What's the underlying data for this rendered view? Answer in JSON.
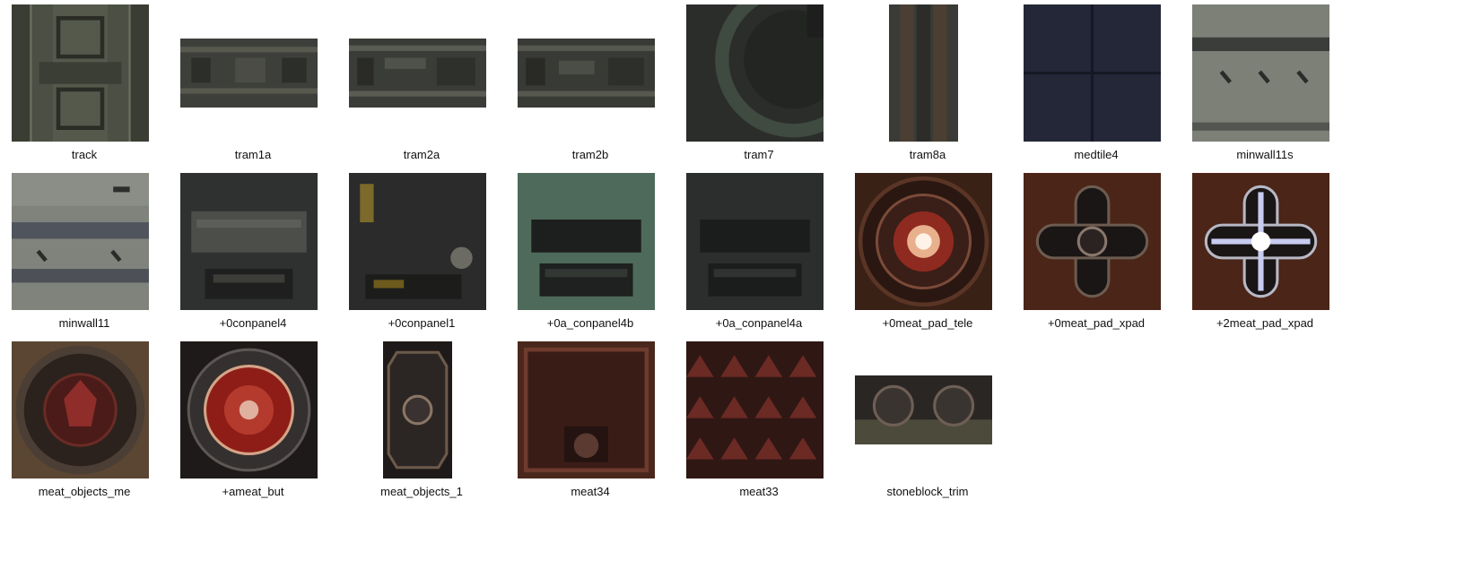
{
  "textures": [
    {
      "name": "track",
      "kind": "track"
    },
    {
      "name": "tram1a",
      "kind": "tram"
    },
    {
      "name": "tram2a",
      "kind": "tram"
    },
    {
      "name": "tram2b",
      "kind": "tram"
    },
    {
      "name": "tram7",
      "kind": "tram7"
    },
    {
      "name": "tram8a",
      "kind": "tram8"
    },
    {
      "name": "medtile4",
      "kind": "medtile"
    },
    {
      "name": "minwall11s",
      "kind": "minwall"
    },
    {
      "name": "minwall11",
      "kind": "minwall"
    },
    {
      "name": "+0conpanel4",
      "kind": "conpanel"
    },
    {
      "name": "+0conpanel1",
      "kind": "conpanel1"
    },
    {
      "name": "+0a_conpanel4b",
      "kind": "conpanel_green"
    },
    {
      "name": "+0a_conpanel4a",
      "kind": "conpanel"
    },
    {
      "name": "+0meat_pad_tele",
      "kind": "pad_tele"
    },
    {
      "name": "+0meat_pad_xpad",
      "kind": "pad_x"
    },
    {
      "name": "+2meat_pad_xpad",
      "kind": "pad_x_lit"
    },
    {
      "name": "meat_objects_me",
      "kind": "meat_disc"
    },
    {
      "name": "+ameat_but",
      "kind": "meat_button"
    },
    {
      "name": "meat_objects_1",
      "kind": "meat_panel"
    },
    {
      "name": "meat34",
      "kind": "meat_skull"
    },
    {
      "name": "meat33",
      "kind": "meat_tris"
    },
    {
      "name": "stoneblock_trim",
      "kind": "stone_trim"
    }
  ]
}
